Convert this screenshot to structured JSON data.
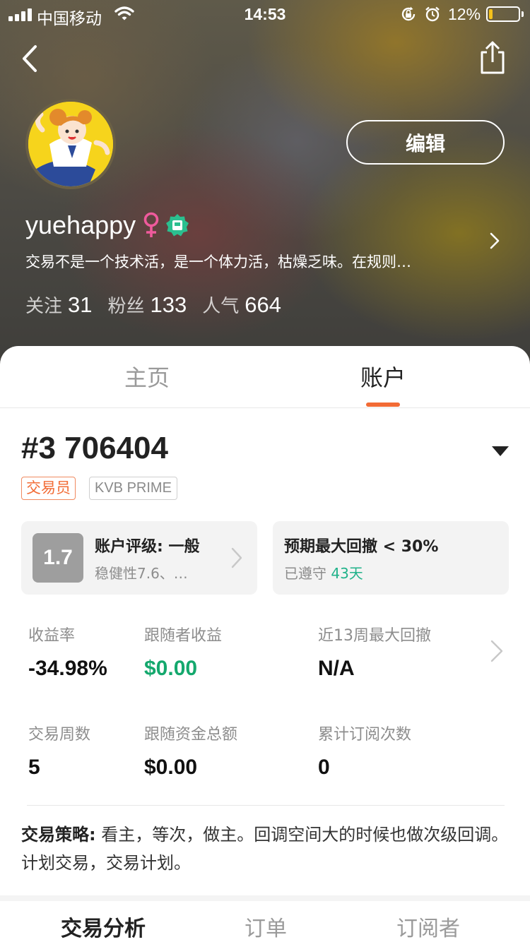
{
  "status_bar": {
    "carrier": "中国移动",
    "time": "14:53",
    "battery_percent": "12%",
    "battery_level": 0.12,
    "icons": [
      "signal-icon",
      "wifi-icon",
      "rotation-lock-icon",
      "alarm-icon",
      "battery-icon"
    ]
  },
  "header": {
    "back_icon": "chevron-left-icon",
    "share_icon": "share-icon",
    "edit_label": "编辑",
    "username": "yuehappy",
    "gender_icon": "female-icon",
    "verified_icon": "verified-badge-icon",
    "bio": "交易不是一个技术活，是一个体力活，枯燥乏味。在规则…",
    "stats": [
      {
        "label": "关注",
        "value": "31"
      },
      {
        "label": "粉丝",
        "value": "133"
      },
      {
        "label": "人气",
        "value": "664"
      }
    ]
  },
  "tabs": {
    "home": "主页",
    "account": "账户",
    "active": "account"
  },
  "account": {
    "number": "#3 706404",
    "tags": [
      "交易员",
      "KVB PRIME"
    ],
    "rating": {
      "score": "1.7",
      "title": "账户评级: 一般",
      "subtitle": "稳健性7.6、…"
    },
    "drawdown": {
      "title": "预期最大回撤 < 30%",
      "status_prefix": "已遵守",
      "days": "43天"
    },
    "metrics": [
      {
        "label": "收益率",
        "value": "-34.98%"
      },
      {
        "label": "跟随者收益",
        "value": "$0.00"
      },
      {
        "label": "近13周最大回撤",
        "value": "N/A"
      },
      {
        "label": "交易周数",
        "value": "5"
      },
      {
        "label": "跟随资金总额",
        "value": "$0.00"
      },
      {
        "label": "累计订阅次数",
        "value": "0"
      }
    ],
    "strategy_label": "交易策略:",
    "strategy_text": " 看主，等次，做主。回调空间大的时候也做次级回调。计划交易，交易计划。"
  },
  "subtabs": {
    "analysis": "交易分析",
    "orders": "订单",
    "subscribers": "订阅者",
    "active": "analysis"
  },
  "colors": {
    "accent": "#f26b35",
    "positive_green": "#14a86d",
    "days_green": "#20b28a",
    "verified_green": "#2bbf8f",
    "female_pink": "#ef5a9c"
  }
}
